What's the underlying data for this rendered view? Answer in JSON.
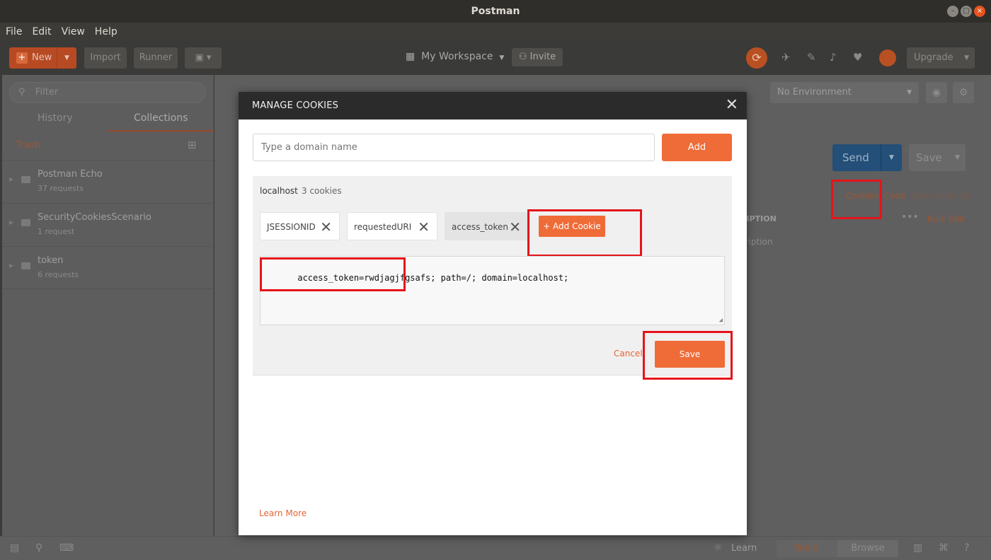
{
  "window": {
    "title": "Postman"
  },
  "menu": [
    "File",
    "Edit",
    "View",
    "Help"
  ],
  "toolbar": {
    "new_label": "New",
    "import_label": "Import",
    "runner_label": "Runner",
    "workspace_label": "My Workspace",
    "invite_label": "Invite",
    "upgrade_label": "Upgrade"
  },
  "sidebar": {
    "filter_placeholder": "Filter",
    "tabs": [
      "History",
      "Collections"
    ],
    "active_tab": "Collections",
    "trash_label": "Trash",
    "collections": [
      {
        "name": "Postman Echo",
        "count": "37 requests"
      },
      {
        "name": "SecurityCookiesScenario",
        "count": "1 request"
      },
      {
        "name": "token",
        "count": "6 requests"
      }
    ]
  },
  "main": {
    "environment": "No Environment",
    "send_label": "Send",
    "save_label": "Save",
    "cookies_link": "Cookies",
    "code_link": "Code",
    "comments_link": "Comments (0)",
    "description_header": "RIPTION",
    "bulk_edit": "Bulk Edit",
    "description_placeholder": "cription"
  },
  "modal": {
    "title": "MANAGE COOKIES",
    "domain_placeholder": "Type a domain name",
    "add_label": "Add",
    "domain": "localhost",
    "cookie_count": "3 cookies",
    "cookies": [
      "JSESSIONID",
      "requestedURI",
      "access_token"
    ],
    "active_cookie": "access_token",
    "add_cookie_label": "+ Add Cookie",
    "cookie_value": "access_token=rwdjagjfgsafs; path=/; domain=localhost;",
    "cancel_label": "Cancel",
    "save_label": "Save",
    "learn_more": "Learn More"
  },
  "statusbar": {
    "learn_label": "Learn",
    "build_label": "Build",
    "browse_label": "Browse"
  },
  "colors": {
    "accent": "#ef6b37",
    "highlight": "#e5141b",
    "send_blue": "#234f78"
  }
}
